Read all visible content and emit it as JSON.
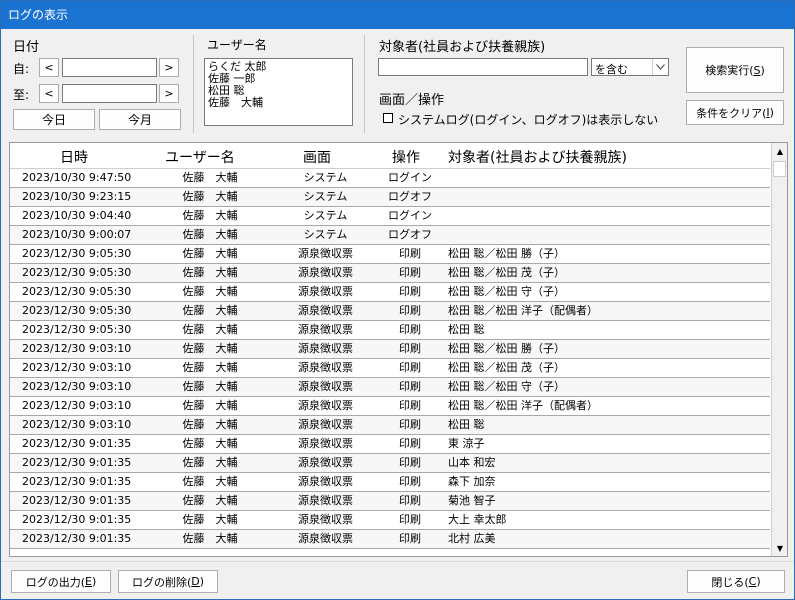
{
  "window": {
    "title": "ログの表示"
  },
  "date_filter": {
    "label": "日付",
    "from_label": "自:",
    "to_label": "至:",
    "prev_glyph": "<",
    "next_glyph": ">",
    "from_value": "",
    "to_value": "",
    "today_label": "今日",
    "month_label": "今月"
  },
  "user_filter": {
    "label": "ユーザー名",
    "users": [
      "らくだ 太郎",
      "佐藤 一郎",
      "松田 聡",
      "佐藤　大輔"
    ]
  },
  "target_filter": {
    "label": "対象者(社員および扶養親族)",
    "value": "",
    "match_mode": "を含む"
  },
  "screen_op": {
    "label": "画面／操作",
    "exclude_system_label": "システムログ(ログイン、ログオフ)は表示しない",
    "exclude_system_checked": false
  },
  "actions": {
    "search": {
      "text": "検索実行(",
      "key": "S",
      "close": ")"
    },
    "clear": {
      "text": "条件をクリア(",
      "key": "I",
      "close": ")"
    }
  },
  "grid": {
    "columns": [
      "日時",
      "ユーザー名",
      "画面",
      "操作",
      "対象者(社員および扶養親族)"
    ],
    "rows": [
      [
        "2023/10/30 9:47:50",
        "佐藤　大輔",
        "システム",
        "ログイン",
        ""
      ],
      [
        "2023/10/30 9:23:15",
        "佐藤　大輔",
        "システム",
        "ログオフ",
        ""
      ],
      [
        "2023/10/30 9:04:40",
        "佐藤　大輔",
        "システム",
        "ログイン",
        ""
      ],
      [
        "2023/10/30 9:00:07",
        "佐藤　大輔",
        "システム",
        "ログオフ",
        ""
      ],
      [
        "2023/12/30 9:05:30",
        "佐藤　大輔",
        "源泉徴収票",
        "印刷",
        "松田 聡／松田 勝（子）"
      ],
      [
        "2023/12/30 9:05:30",
        "佐藤　大輔",
        "源泉徴収票",
        "印刷",
        "松田 聡／松田 茂（子）"
      ],
      [
        "2023/12/30 9:05:30",
        "佐藤　大輔",
        "源泉徴収票",
        "印刷",
        "松田 聡／松田 守（子）"
      ],
      [
        "2023/12/30 9:05:30",
        "佐藤　大輔",
        "源泉徴収票",
        "印刷",
        "松田 聡／松田 洋子（配偶者）"
      ],
      [
        "2023/12/30 9:05:30",
        "佐藤　大輔",
        "源泉徴収票",
        "印刷",
        "松田 聡"
      ],
      [
        "2023/12/30 9:03:10",
        "佐藤　大輔",
        "源泉徴収票",
        "印刷",
        "松田 聡／松田 勝（子）"
      ],
      [
        "2023/12/30 9:03:10",
        "佐藤　大輔",
        "源泉徴収票",
        "印刷",
        "松田 聡／松田 茂（子）"
      ],
      [
        "2023/12/30 9:03:10",
        "佐藤　大輔",
        "源泉徴収票",
        "印刷",
        "松田 聡／松田 守（子）"
      ],
      [
        "2023/12/30 9:03:10",
        "佐藤　大輔",
        "源泉徴収票",
        "印刷",
        "松田 聡／松田 洋子（配偶者）"
      ],
      [
        "2023/12/30 9:03:10",
        "佐藤　大輔",
        "源泉徴収票",
        "印刷",
        "松田 聡"
      ],
      [
        "2023/12/30 9:01:35",
        "佐藤　大輔",
        "源泉徴収票",
        "印刷",
        "東 涼子"
      ],
      [
        "2023/12/30 9:01:35",
        "佐藤　大輔",
        "源泉徴収票",
        "印刷",
        "山本 和宏"
      ],
      [
        "2023/12/30 9:01:35",
        "佐藤　大輔",
        "源泉徴収票",
        "印刷",
        "森下 加奈"
      ],
      [
        "2023/12/30 9:01:35",
        "佐藤　大輔",
        "源泉徴収票",
        "印刷",
        "菊池 智子"
      ],
      [
        "2023/12/30 9:01:35",
        "佐藤　大輔",
        "源泉徴収票",
        "印刷",
        "大上 幸太郎"
      ],
      [
        "2023/12/30 9:01:35",
        "佐藤　大輔",
        "源泉徴収票",
        "印刷",
        "北村 広美"
      ]
    ],
    "scroll_up_glyph": "▲",
    "scroll_down_glyph": "▼"
  },
  "footer": {
    "export": {
      "text": "ログの出力(",
      "key": "E",
      "close": ")"
    },
    "delete": {
      "text": "ログの削除(",
      "key": "D",
      "close": ")"
    },
    "close": {
      "text": "閉じる(",
      "key": "C",
      "close": ")"
    }
  },
  "icons": {
    "combo_arrow": "chevron-down-icon",
    "scroll_up": "arrow-up-icon",
    "scroll_down": "arrow-down-icon"
  }
}
